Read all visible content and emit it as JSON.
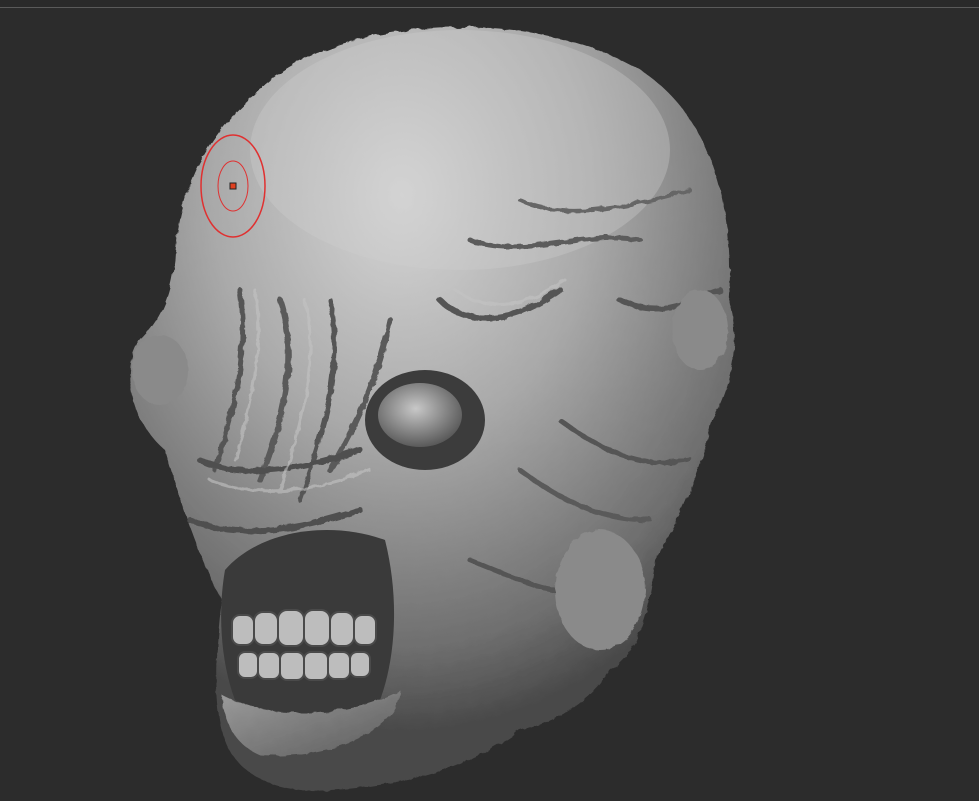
{
  "app": {
    "viewport_label": "",
    "background_color": "#2c2c2c",
    "top_rule_color": "#5a5a5a"
  },
  "model": {
    "type": "sculpted creature head",
    "material_color": "#9a9a9a",
    "highlight_color": "#d4d4d4",
    "shadow_color": "#3a3a3a"
  },
  "brush_cursor": {
    "icon": "brush-cursor-icon",
    "color": "#e03030"
  }
}
